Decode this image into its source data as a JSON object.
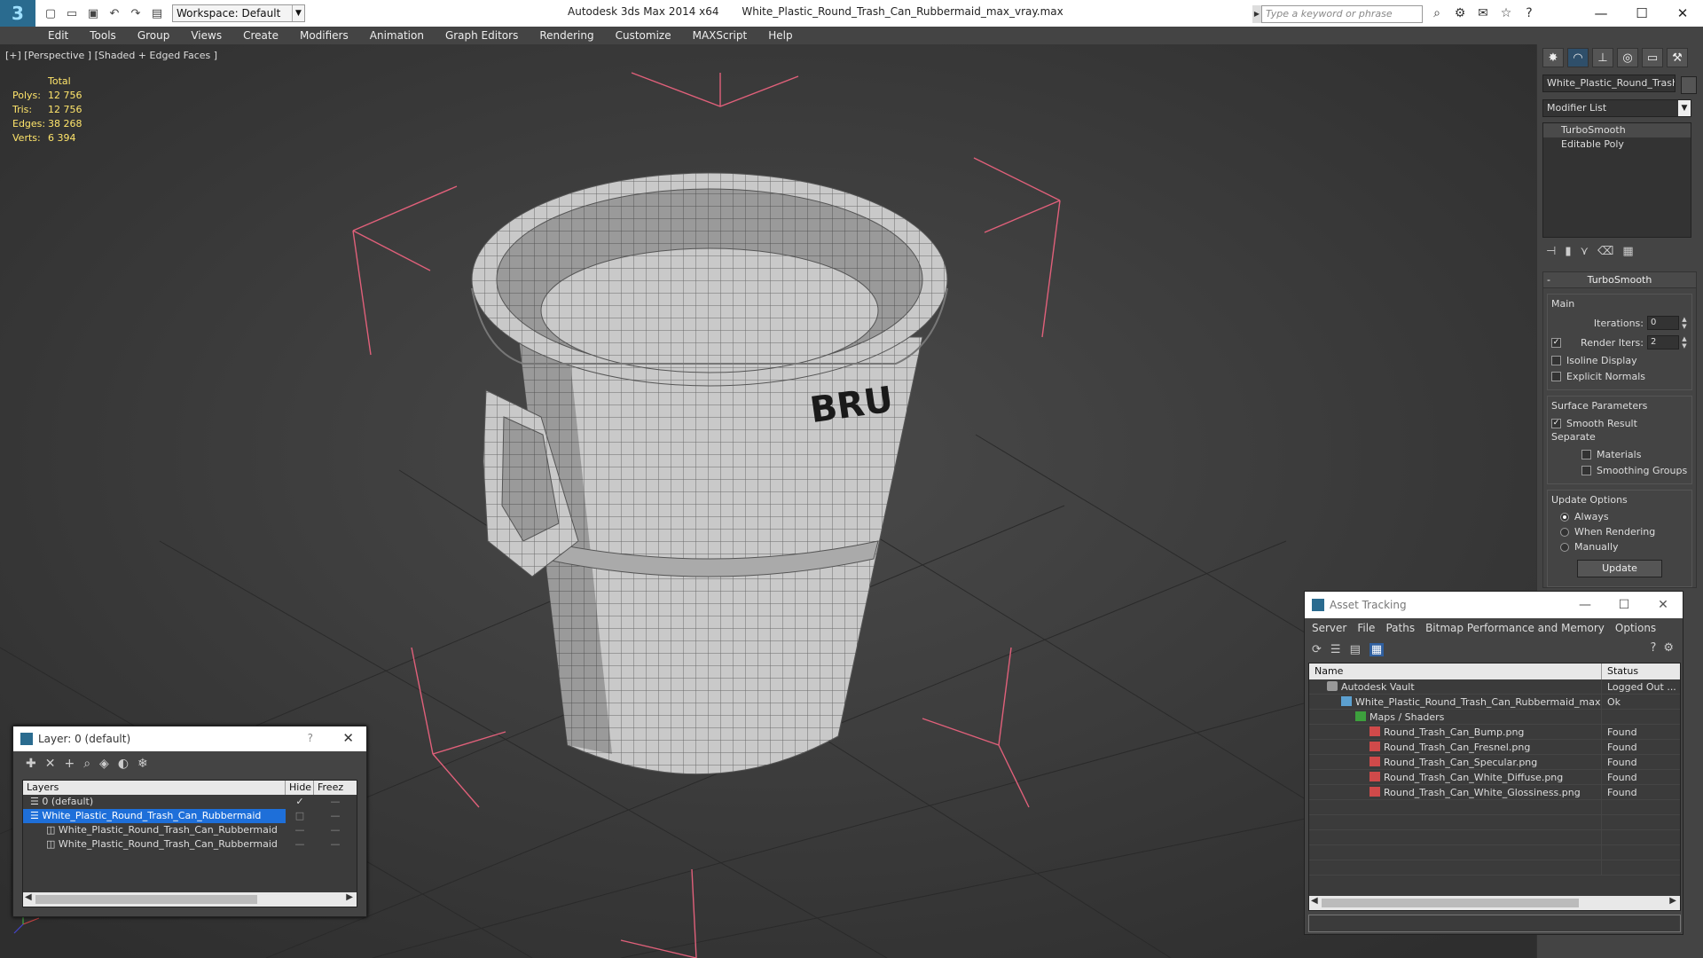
{
  "titlebar": {
    "app": "Autodesk 3ds Max  2014 x64",
    "file": "White_Plastic_Round_Trash_Can_Rubbermaid_max_vray.max",
    "workspace": "Workspace: Default",
    "search_placeholder": "Type a keyword or phrase"
  },
  "menu": [
    "Edit",
    "Tools",
    "Group",
    "Views",
    "Create",
    "Modifiers",
    "Animation",
    "Graph Editors",
    "Rendering",
    "Customize",
    "MAXScript",
    "Help"
  ],
  "viewport": {
    "label": "[+] [Perspective ] [Shaded + Edged Faces ]",
    "stats_header": "Total",
    "stats": [
      {
        "k": "Polys:",
        "v": "12 756"
      },
      {
        "k": "Tris:",
        "v": "12 756"
      },
      {
        "k": "Edges:",
        "v": "38 268"
      },
      {
        "k": "Verts:",
        "v": "6 394"
      }
    ],
    "decal_text": "BRU"
  },
  "cmdpanel": {
    "object_name": "White_Plastic_Round_Trash_",
    "modifier_list": "Modifier List",
    "stack": [
      "TurboSmooth",
      "Editable Poly"
    ],
    "rollout_title": "TurboSmooth",
    "main_label": "Main",
    "iterations_label": "Iterations:",
    "iterations_value": "0",
    "render_iters_label": "Render Iters:",
    "render_iters_value": "2",
    "isoline": "Isoline Display",
    "explicit": "Explicit Normals",
    "surface_label": "Surface Parameters",
    "smooth_result": "Smooth Result",
    "separate_label": "Separate",
    "materials": "Materials",
    "smoothing_groups": "Smoothing Groups",
    "update_label": "Update Options",
    "always": "Always",
    "when_rendering": "When Rendering",
    "manually": "Manually",
    "update_btn": "Update"
  },
  "layer_dialog": {
    "title": "Layer: 0 (default)",
    "help": "?",
    "col_layers": "Layers",
    "col_hide": "Hide",
    "col_freeze": "Freez",
    "rows": [
      {
        "name": "0 (default)",
        "indent": "0",
        "selected": false
      },
      {
        "name": "White_Plastic_Round_Trash_Can_Rubbermaid",
        "indent": "0",
        "selected": true
      },
      {
        "name": "White_Plastic_Round_Trash_Can_Rubbermaid",
        "indent": "1",
        "selected": false
      },
      {
        "name": "White_Plastic_Round_Trash_Can_Rubbermaid",
        "indent": "1",
        "selected": false
      }
    ]
  },
  "asset_dialog": {
    "title": "Asset Tracking",
    "menu": [
      "Server",
      "File",
      "Paths",
      "Bitmap Performance and Memory",
      "Options"
    ],
    "col_name": "Name",
    "col_status": "Status",
    "rows": [
      {
        "name": "Autodesk Vault",
        "status": "Logged Out ...",
        "icon": "vault",
        "indent": "1"
      },
      {
        "name": "White_Plastic_Round_Trash_Can_Rubbermaid_max...",
        "status": "Ok",
        "icon": "max",
        "indent": "2"
      },
      {
        "name": "Maps / Shaders",
        "status": "",
        "icon": "folder",
        "indent": "3"
      },
      {
        "name": "Round_Trash_Can_Bump.png",
        "status": "Found",
        "icon": "png",
        "indent": "4"
      },
      {
        "name": "Round_Trash_Can_Fresnel.png",
        "status": "Found",
        "icon": "png",
        "indent": "4"
      },
      {
        "name": "Round_Trash_Can_Specular.png",
        "status": "Found",
        "icon": "png",
        "indent": "4"
      },
      {
        "name": "Round_Trash_Can_White_Diffuse.png",
        "status": "Found",
        "icon": "png",
        "indent": "4"
      },
      {
        "name": "Round_Trash_Can_White_Glossiness.png",
        "status": "Found",
        "icon": "png",
        "indent": "4"
      }
    ]
  },
  "colors": {
    "stats": "#ffe56b",
    "selection": "#1e6fd9",
    "bbox": "#e0607a"
  }
}
